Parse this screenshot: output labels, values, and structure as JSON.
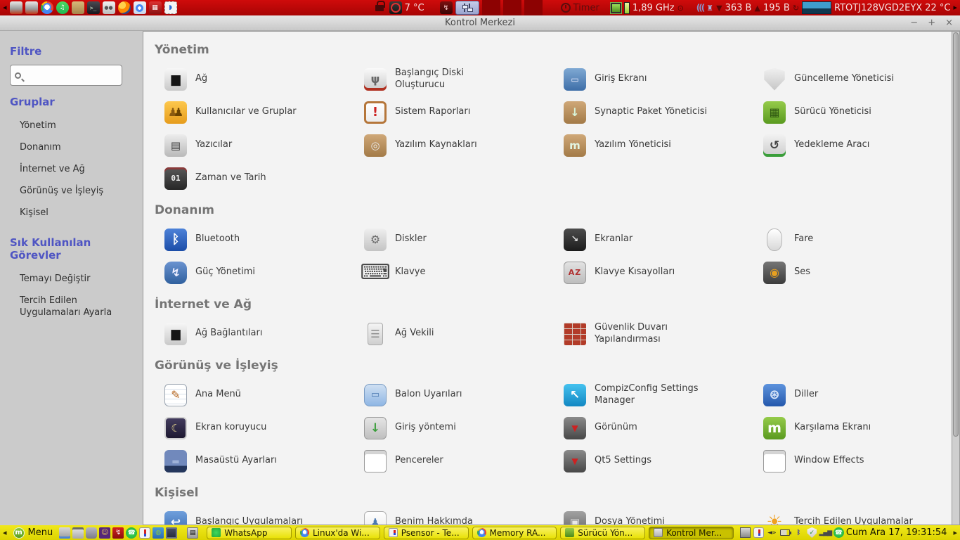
{
  "colors": {
    "panel_red": "#c40808",
    "panel_yellow": "#e9e100",
    "heading_blue": "#4f55c3",
    "section_gray": "#757575"
  },
  "top_panel": {
    "temperature": "7 °C",
    "timer_label": "Timer",
    "cpu_freq": "1,89 GHz",
    "net_down": "363 B",
    "net_up": "195 B",
    "disk_id": "RTOTJ128VGD2EYX",
    "disk_temp": "22 °C"
  },
  "window": {
    "title": "Kontrol Merkezi",
    "controls": {
      "minimize": "−",
      "maximize": "+",
      "close": "×"
    }
  },
  "sidebar": {
    "filter_heading": "Filtre",
    "groups_heading": "Gruplar",
    "groups": [
      "Yönetim",
      "Donanım",
      "İnternet ve Ağ",
      "Görünüş ve İşleyiş",
      "Kişisel"
    ],
    "tasks_heading": "Sık Kullanılan Görevler",
    "tasks": [
      "Temayı Değiştir",
      "Tercih Edilen Uygulamaları Ayarla"
    ]
  },
  "sections": [
    {
      "title": "Yönetim",
      "items": [
        {
          "label": "Ağ",
          "icon": "network"
        },
        {
          "label": "Başlangıç Diski Oluşturucu",
          "icon": "usb"
        },
        {
          "label": "Giriş Ekranı",
          "icon": "login"
        },
        {
          "label": "Güncelleme Yöneticisi",
          "icon": "shield"
        },
        {
          "label": "Kullanıcılar ve Gruplar",
          "icon": "users"
        },
        {
          "label": "Sistem Raporları",
          "icon": "report"
        },
        {
          "label": "Synaptic Paket Yöneticisi",
          "icon": "synaptic"
        },
        {
          "label": "Sürücü Yöneticisi",
          "icon": "driver"
        },
        {
          "label": "Yazıcılar",
          "icon": "printer"
        },
        {
          "label": "Yazılım Kaynakları",
          "icon": "sources"
        },
        {
          "label": "Yazılım Yöneticisi",
          "icon": "softman"
        },
        {
          "label": "Yedekleme Aracı",
          "icon": "backup"
        },
        {
          "label": "Zaman ve Tarih",
          "icon": "datetime"
        }
      ]
    },
    {
      "title": "Donanım",
      "items": [
        {
          "label": "Bluetooth",
          "icon": "bluetooth"
        },
        {
          "label": "Diskler",
          "icon": "disks"
        },
        {
          "label": "Ekranlar",
          "icon": "displays"
        },
        {
          "label": "Fare",
          "icon": "mouse"
        },
        {
          "label": "Güç Yönetimi",
          "icon": "powermgmt"
        },
        {
          "label": "Klavye",
          "icon": "keyboard"
        },
        {
          "label": "Klavye Kısayolları",
          "icon": "shortcuts"
        },
        {
          "label": "Ses",
          "icon": "sound"
        }
      ]
    },
    {
      "title": "İnternet ve Ağ",
      "items": [
        {
          "label": "Ağ Bağlantıları",
          "icon": "network"
        },
        {
          "label": "Ağ Vekili",
          "icon": "proxy"
        },
        {
          "label": "Güvenlik Duvarı Yapılandırması",
          "icon": "firewall"
        }
      ]
    },
    {
      "title": "Görünüş ve İşleyiş",
      "items": [
        {
          "label": "Ana Menü",
          "icon": "mainmenu"
        },
        {
          "label": "Balon Uyarıları",
          "icon": "notify"
        },
        {
          "label": "CompizConfig Settings Manager",
          "icon": "ccsm"
        },
        {
          "label": "Diller",
          "icon": "languages"
        },
        {
          "label": "Ekran koruyucu",
          "icon": "screensaver"
        },
        {
          "label": "Giriş yöntemi",
          "icon": "inputmethod"
        },
        {
          "label": "Görünüm",
          "icon": "suit"
        },
        {
          "label": "Karşılama Ekranı",
          "icon": "welcome"
        },
        {
          "label": "Masaüstü Ayarları",
          "icon": "desktop"
        },
        {
          "label": "Pencereler",
          "icon": "window"
        },
        {
          "label": "Qt5 Settings",
          "icon": "suit"
        },
        {
          "label": "Window Effects",
          "icon": "window"
        }
      ]
    },
    {
      "title": "Kişisel",
      "items": [
        {
          "label": "Başlangıç Uygulamaları",
          "icon": "startup"
        },
        {
          "label": "Benim Hakkımda",
          "icon": "aboutme"
        },
        {
          "label": "Dosya Yönetimi",
          "icon": "filemgmt"
        },
        {
          "label": "Tercih Edilen Uygulamalar",
          "icon": "preferred"
        }
      ]
    }
  ],
  "icon_glyphs": {
    "network": "▆",
    "usb": "ψ",
    "login": "▭",
    "shield": "",
    "users": "♟",
    "report": "!",
    "synaptic": "↓",
    "driver": "▦",
    "printer": "▤",
    "sources": "◎",
    "softman": "m",
    "backup": "↺",
    "datetime": "01",
    "bluetooth": "ᛒ",
    "disks": "⚙",
    "displays": "↘",
    "mouse": "",
    "powermgmt": "↯",
    "keyboard": "⌨",
    "shortcuts": "AZ",
    "sound": "◉",
    "proxy": "☰",
    "firewall": "",
    "mainmenu": "✎",
    "notify": "▭",
    "ccsm": "↖",
    "languages": "⊛",
    "screensaver": "☾",
    "inputmethod": "↓",
    "suit": "▼",
    "welcome": "m",
    "desktop": "▬",
    "window": "",
    "startup": "↩",
    "aboutme": "♟",
    "filemgmt": "▣",
    "preferred": "☀"
  },
  "taskbar": {
    "menu_label": "Menu",
    "buttons": [
      {
        "label": "WhatsApp",
        "icon": "tb-whatsapp",
        "active": false
      },
      {
        "label": "Linux'da Wi...",
        "icon": "tb-chrome",
        "active": false
      },
      {
        "label": "Psensor - Te...",
        "icon": "tb-thermo",
        "active": false
      },
      {
        "label": "Memory RA...",
        "icon": "tb-chrome",
        "active": false
      },
      {
        "label": "Sürücü Yön...",
        "icon": "tb-driver",
        "active": false
      },
      {
        "label": "Kontrol Mer...",
        "icon": "tb-cc",
        "active": true
      }
    ],
    "clock": "Cum Ara 17, 19:31:54"
  }
}
